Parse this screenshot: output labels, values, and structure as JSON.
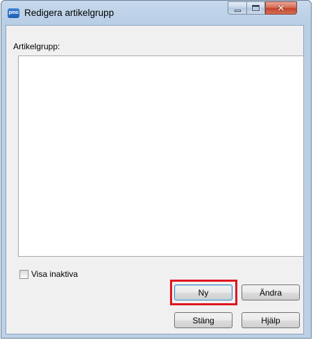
{
  "window": {
    "title": "Redigera artikelgrupp",
    "app_icon_text": "pmo",
    "controls": {
      "minimize": "minimize-icon",
      "maximize": "maximize-icon",
      "close": "close-icon"
    }
  },
  "form": {
    "group_label": "Artikelgrupp:",
    "list_items": [],
    "show_inactive_label": "Visa inaktiva",
    "show_inactive_checked": false
  },
  "buttons": {
    "new": "Ny",
    "edit": "Ändra",
    "close": "Stäng",
    "help": "Hjälp"
  },
  "highlight": {
    "target": "new-button",
    "color": "#e0141e"
  }
}
